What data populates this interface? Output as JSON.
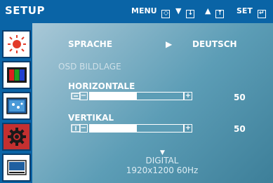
{
  "header": {
    "title": "SETUP",
    "menu_hint": "MENU",
    "set_hint": "SET"
  },
  "sidebar": {
    "items": [
      {
        "icon": "brightness-icon",
        "active": false
      },
      {
        "icon": "color-bars-icon",
        "active": false
      },
      {
        "icon": "image-icon",
        "active": false
      },
      {
        "icon": "gear-icon",
        "active": true
      },
      {
        "icon": "osd-window-icon",
        "active": false
      }
    ]
  },
  "main": {
    "language": {
      "label": "SPRACHE",
      "value": "DEUTSCH"
    },
    "section": "OSD BILDLAGE",
    "horizontal": {
      "label": "HORIZONTALE",
      "value": "50",
      "level": 0.5
    },
    "vertical": {
      "label": "VERTIKAL",
      "value": "50",
      "level": 0.5
    },
    "signal": {
      "type": "DIGITAL",
      "resolution": "1920x1200 60Hz"
    }
  },
  "colors": {
    "bar_blue": "#0a64a6",
    "panel_teal": "#5c9db6",
    "active_red": "#c43030"
  }
}
